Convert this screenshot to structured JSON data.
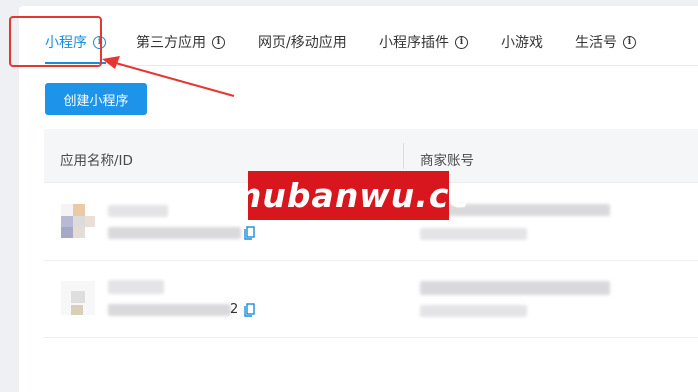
{
  "tabs": [
    {
      "label": "小程序",
      "has_info": true,
      "active": true
    },
    {
      "label": "第三方应用",
      "has_info": true,
      "active": false
    },
    {
      "label": "网页/移动应用",
      "has_info": false,
      "active": false
    },
    {
      "label": "小程序插件",
      "has_info": true,
      "active": false
    },
    {
      "label": "小游戏",
      "has_info": false,
      "active": false
    },
    {
      "label": "生活号",
      "has_info": true,
      "active": false
    }
  ],
  "toolbar": {
    "create_label": "创建小程序"
  },
  "table": {
    "columns": [
      "应用名称/ID",
      "商家账号"
    ],
    "rows": [
      {
        "id_suffix": ""
      },
      {
        "id_suffix": "2"
      }
    ]
  },
  "watermark": "mubanwu.cc",
  "colors": {
    "accent": "#1a8cdf",
    "button": "#1d93e9",
    "annotation": "#e5372f",
    "watermark_bg": "#d7161d"
  }
}
